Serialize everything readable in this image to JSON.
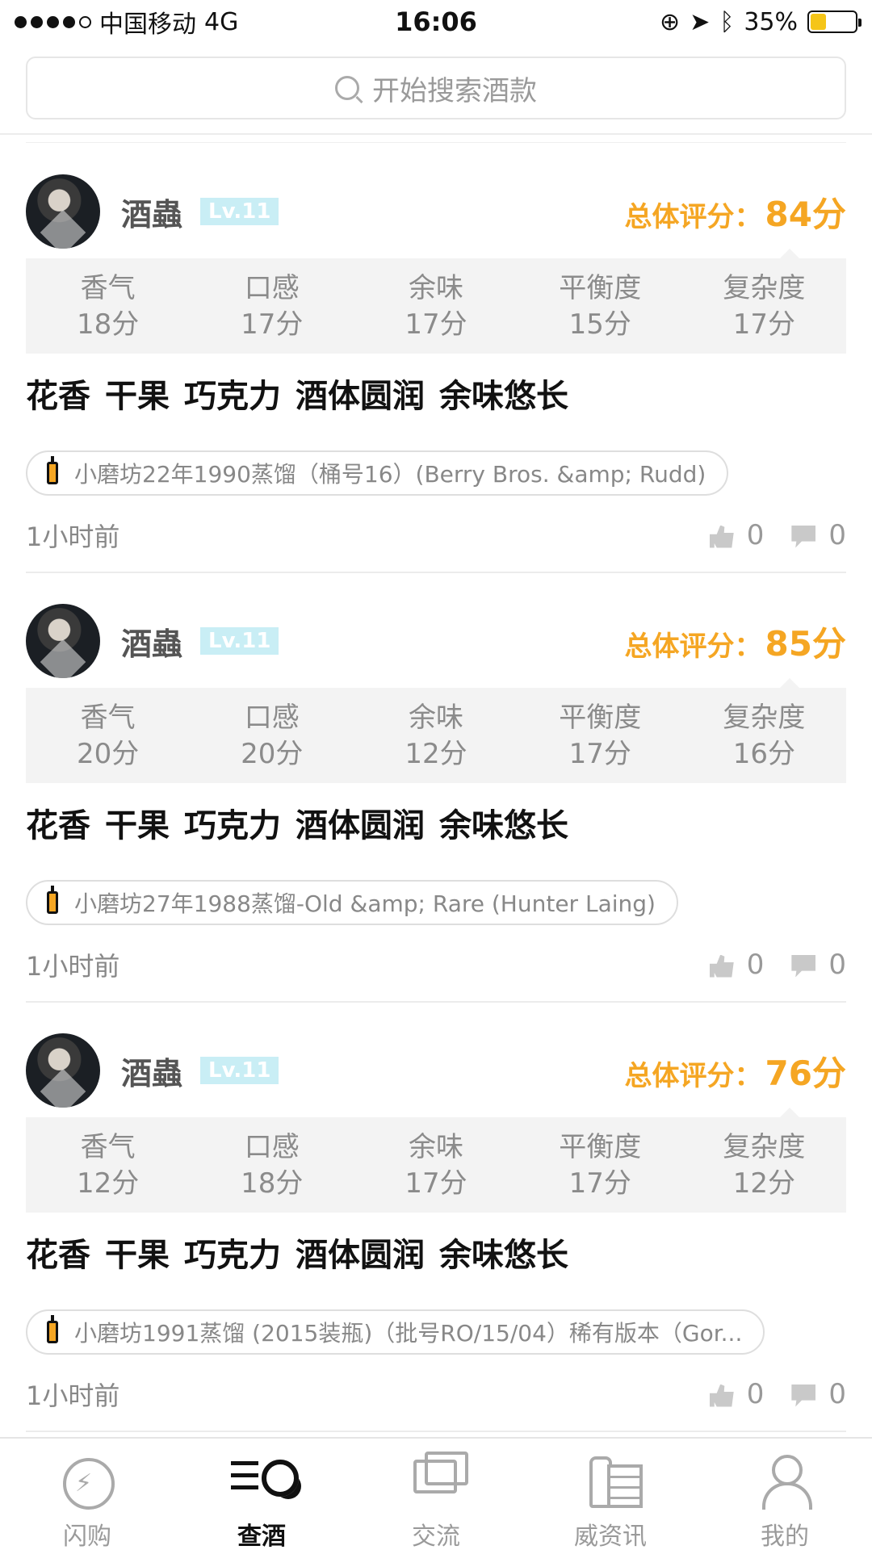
{
  "status_bar": {
    "carrier": "中国移动",
    "network": "4G",
    "time": "16:06",
    "battery": "35%",
    "battery_percent": 0.35
  },
  "search": {
    "placeholder": "开始搜索酒款"
  },
  "reviews": [
    {
      "username": "酒蟲",
      "level": "Lv.11",
      "overall_label": "总体评分：",
      "overall_score": "84分",
      "scores": [
        {
          "label": "香气",
          "value": "18分"
        },
        {
          "label": "口感",
          "value": "17分"
        },
        {
          "label": "余味",
          "value": "17分"
        },
        {
          "label": "平衡度",
          "value": "15分"
        },
        {
          "label": "复杂度",
          "value": "17分"
        }
      ],
      "tags": [
        "花香",
        "干果",
        "巧克力",
        "酒体圆润",
        "余味悠长"
      ],
      "product": "小磨坊22年1990蒸馏（桶号16）(Berry Bros. &amp; Rudd)",
      "time": "1小时前",
      "likes": "0",
      "comments": "0"
    },
    {
      "username": "酒蟲",
      "level": "Lv.11",
      "overall_label": "总体评分：",
      "overall_score": "85分",
      "scores": [
        {
          "label": "香气",
          "value": "20分"
        },
        {
          "label": "口感",
          "value": "20分"
        },
        {
          "label": "余味",
          "value": "12分"
        },
        {
          "label": "平衡度",
          "value": "17分"
        },
        {
          "label": "复杂度",
          "value": "16分"
        }
      ],
      "tags": [
        "花香",
        "干果",
        "巧克力",
        "酒体圆润",
        "余味悠长"
      ],
      "product": "小磨坊27年1988蒸馏-Old &amp; Rare (Hunter Laing)",
      "time": "1小时前",
      "likes": "0",
      "comments": "0"
    },
    {
      "username": "酒蟲",
      "level": "Lv.11",
      "overall_label": "总体评分：",
      "overall_score": "76分",
      "scores": [
        {
          "label": "香气",
          "value": "12分"
        },
        {
          "label": "口感",
          "value": "18分"
        },
        {
          "label": "余味",
          "value": "17分"
        },
        {
          "label": "平衡度",
          "value": "17分"
        },
        {
          "label": "复杂度",
          "value": "12分"
        }
      ],
      "tags": [
        "花香",
        "干果",
        "巧克力",
        "酒体圆润",
        "余味悠长"
      ],
      "product": "小磨坊1991蒸馏 (2015装瓶)（批号RO/15/04）稀有版本（Gor...",
      "time": "1小时前",
      "likes": "0",
      "comments": "0"
    }
  ],
  "tabs": [
    {
      "label": "闪购",
      "icon": "flash-sale-icon"
    },
    {
      "label": "查酒",
      "icon": "search-wine-icon",
      "active": true
    },
    {
      "label": "交流",
      "icon": "chat-icon"
    },
    {
      "label": "威资讯",
      "icon": "news-icon"
    },
    {
      "label": "我的",
      "icon": "profile-icon"
    }
  ],
  "colors": {
    "accent": "#f5a623",
    "level_badge": "#c9eef5",
    "card_bg": "#f3f3f3"
  }
}
